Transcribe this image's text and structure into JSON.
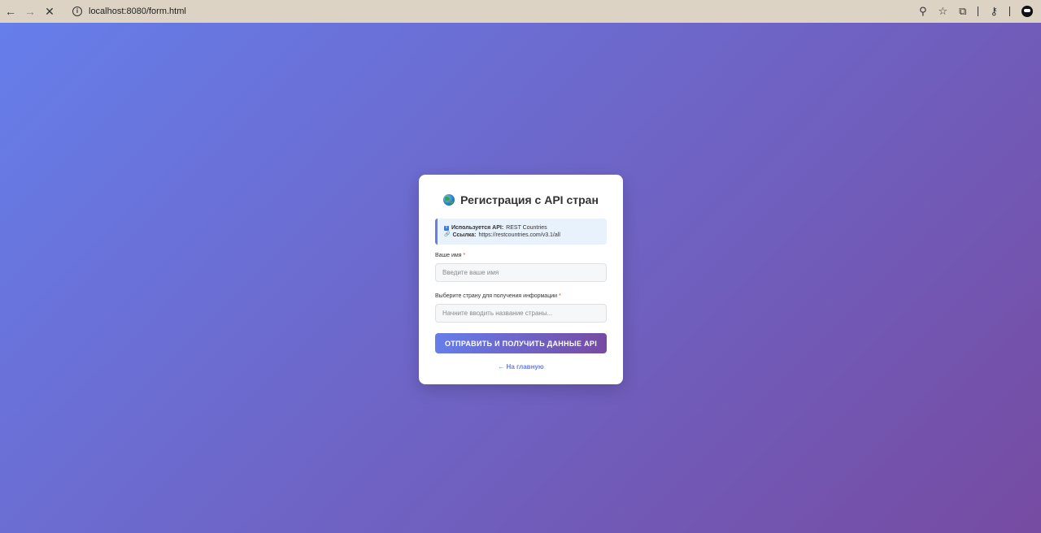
{
  "browser": {
    "back_icon": "←",
    "forward_icon": "→",
    "stop_icon": "✕",
    "info_icon": "i",
    "url": "localhost:8080/form.html",
    "zoom_icon": "⚲",
    "star_icon": "☆",
    "extensions_icon": "⧉",
    "key_icon": "⚷"
  },
  "form": {
    "title": "Регистрация с API стран",
    "info": {
      "api_label": "Используется API:",
      "api_value": "REST Countries",
      "link_label": "Ссылка:",
      "link_value": "https://restcountries.com/v3.1/all"
    },
    "name_label": "Ваше имя",
    "name_placeholder": "Введите ваше имя",
    "country_label": "Выберите страну для получения информации",
    "country_placeholder": "Начните вводить название страны...",
    "required_mark": "*",
    "submit_label": "ОТПРАВИТЬ И ПОЛУЧИТЬ ДАННЫЕ API",
    "home_link": "← На главную"
  },
  "colors": {
    "gradient_start": "#667eea",
    "gradient_end": "#764ba2",
    "info_bg": "#e8f2fd",
    "required": "#e53935"
  }
}
